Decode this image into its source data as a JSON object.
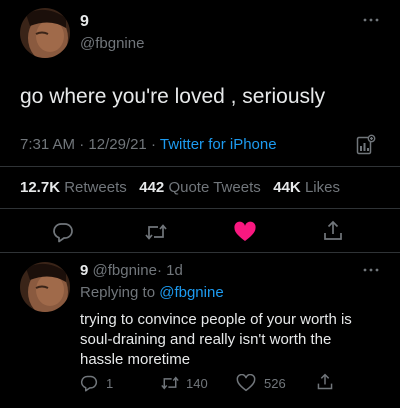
{
  "tweet": {
    "display_name": "9",
    "handle": "@fbgnine",
    "text": "go where you're loved , seriously",
    "time": "7:31 AM",
    "dot1": "·",
    "date": "12/29/21",
    "dot2": "·",
    "source": "Twitter for iPhone",
    "stats": {
      "retweets_count": "12.7K",
      "retweets_label": "Retweets",
      "quotes_count": "442",
      "quotes_label": "Quote Tweets",
      "likes_count": "44K",
      "likes_label": "Likes"
    },
    "liked": true
  },
  "reply": {
    "display_name": "9",
    "handle": "@fbgnine",
    "dot": "·",
    "age": "1d",
    "replying_prefix": "Replying to",
    "replying_handle": "@fbgnine",
    "text_line1": "trying to convince people of your worth is",
    "text_line2": "soul-draining and really isn't worth the",
    "text_line3": "hassle moretime",
    "reply_count": "1",
    "retweet_count": "140",
    "like_count": "526"
  },
  "colors": {
    "background": "#000000",
    "accent": "#1d9bf0",
    "like": "#f91880",
    "muted": "#71767b",
    "text": "#e7e9ea",
    "separator": "#2f3336"
  }
}
